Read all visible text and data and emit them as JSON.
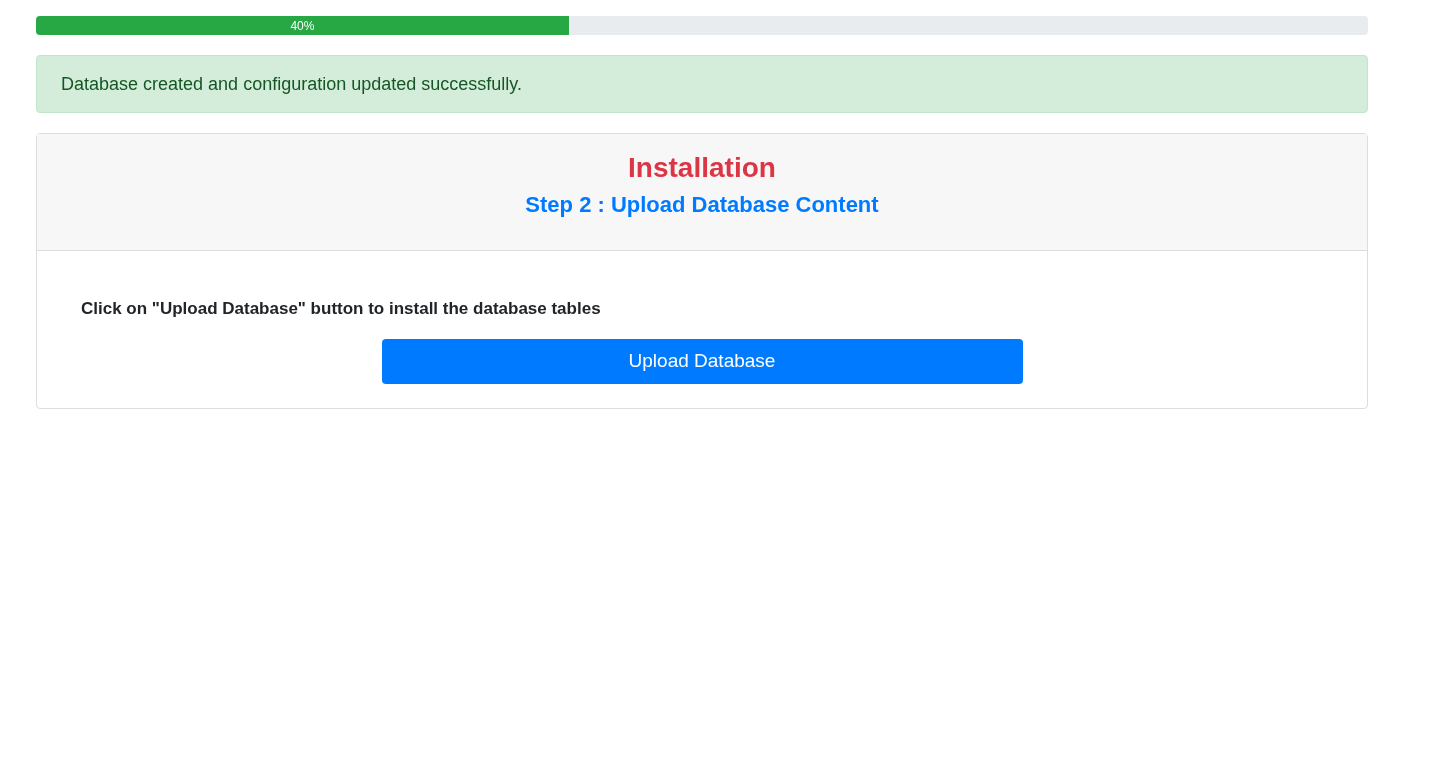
{
  "progress": {
    "level": 0.4,
    "label": "40%"
  },
  "alert": {
    "text": "Database created and configuration updated successfully."
  },
  "card": {
    "title": "Installation",
    "subtitle": "Step 2 : Upload Database Content",
    "instruction": "Click on \"Upload Database\" button to install the database tables",
    "button": "Upload Database"
  }
}
